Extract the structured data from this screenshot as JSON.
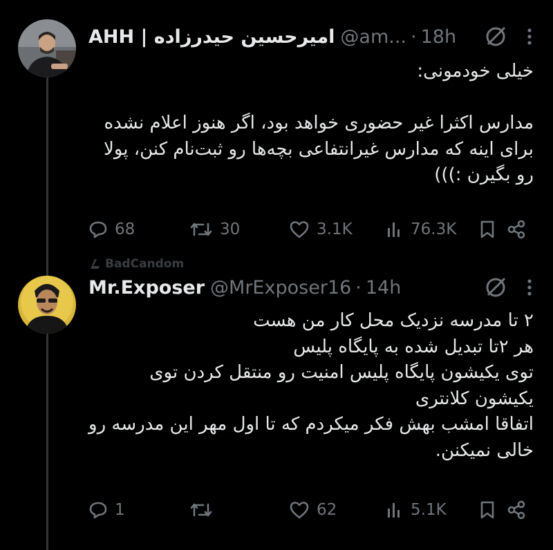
{
  "colors": {
    "background": "#000000",
    "text": "#e7e9ea",
    "muted": "#71767b",
    "thread_line": "#333639"
  },
  "tweets": [
    {
      "name": "AHH | امیرحسین حیدرزاده",
      "handle": "@am...",
      "separator": "·",
      "time": "18h",
      "text": "خیلی خودمونی:\n\nمدارس اکثرا غیر حضوری خواهد بود، اگر هنوز اعلام نشده برای اینه که مدارس غیرانتفاعی بچه‌ها رو ثبت‌نام کنن، پولا رو بگیرن :)))",
      "replies": "68",
      "retweets": "30",
      "likes": "3.1K",
      "views": "76.3K",
      "icons": [
        "grok-icon",
        "more-icon",
        "reply-icon",
        "retweet-icon",
        "like-icon",
        "views-icon",
        "bookmark-icon",
        "share-icon"
      ]
    },
    {
      "name": "Mr.Exposer",
      "handle": "@MrExposer16",
      "separator": "·",
      "time": "14h",
      "text": "۲ تا مدرسه نزدیک محل کار من هست\nهر ۲تا تبدیل شده به پایگاه پلیس\nتوی یکیشون پایگاه پلیس امنیت رو منتقل کردن توی یکیشون کلانتری\nاتفاقا امشب بهش فکر میکردم که تا اول مهر این مدرسه رو خالی نمیکنن.",
      "replies": "1",
      "retweets": "",
      "likes": "62",
      "views": "5.1K",
      "icons": [
        "grok-icon",
        "more-icon",
        "reply-icon",
        "retweet-icon",
        "like-icon",
        "views-icon",
        "bookmark-icon",
        "share-icon"
      ]
    }
  ],
  "watermark": "BadCandom"
}
